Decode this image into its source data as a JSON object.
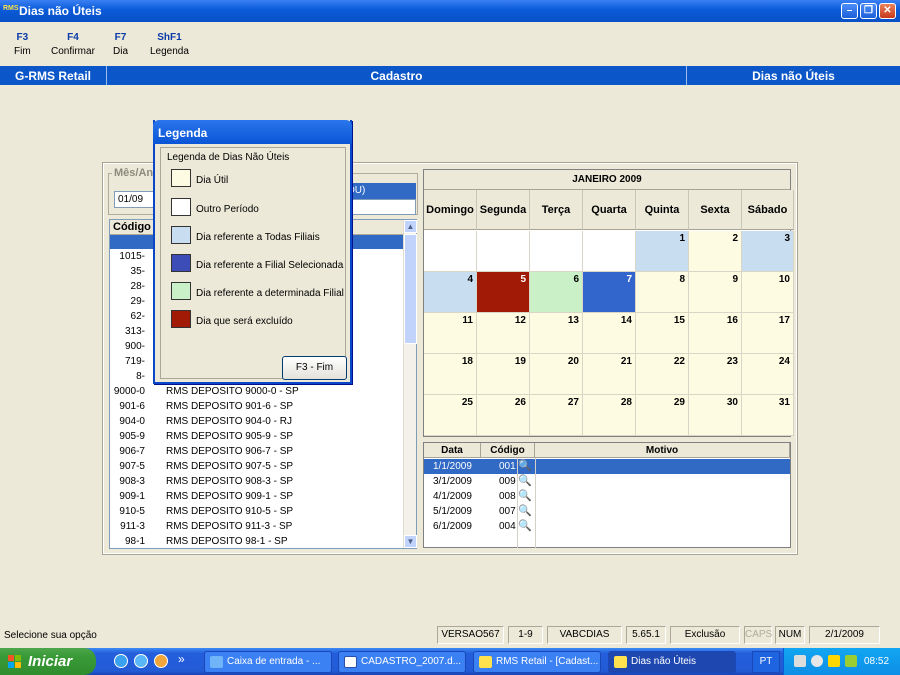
{
  "window": {
    "title": "Dias não Úteis",
    "app_icon": "RMS"
  },
  "fkeys": [
    {
      "key": "F3",
      "label": "Fim"
    },
    {
      "key": "F4",
      "label": "Confirmar"
    },
    {
      "key": "F7",
      "label": "Dia"
    },
    {
      "key": "ShF1",
      "label": "Legenda"
    }
  ],
  "header": {
    "left": "G-RMS Retail",
    "center": "Cadastro",
    "right": "Dias não Úteis"
  },
  "filter": {
    "group_label": "Mês/Ano",
    "month_value": "01/09",
    "selected_suffix": "OU)"
  },
  "list": {
    "header_code": "Código",
    "rows": [
      {
        "code": "1015-",
        "name": ""
      },
      {
        "code": "35-",
        "name": ""
      },
      {
        "code": "28-",
        "name": ""
      },
      {
        "code": "29-",
        "name": ""
      },
      {
        "code": "62-",
        "name": ""
      },
      {
        "code": "313-",
        "name": ""
      },
      {
        "code": "900-",
        "name": ""
      },
      {
        "code": "719-",
        "name": ""
      },
      {
        "code": "8-",
        "name": ""
      },
      {
        "code": "9000-0",
        "name": "RMS DEPOSITO 9000-0 - SP"
      },
      {
        "code": "901-6",
        "name": "RMS DEPOSITO 901-6 - SP"
      },
      {
        "code": "904-0",
        "name": "RMS DEPOSITO 904-0 - RJ"
      },
      {
        "code": "905-9",
        "name": "RMS DEPOSITO 905-9 - SP"
      },
      {
        "code": "906-7",
        "name": "RMS DEPOSITO 906-7 - SP"
      },
      {
        "code": "907-5",
        "name": "RMS DEPOSITO 907-5 - SP"
      },
      {
        "code": "908-3",
        "name": "RMS DEPOSITO 908-3 - SP"
      },
      {
        "code": "909-1",
        "name": "RMS DEPOSITO 909-1 - SP"
      },
      {
        "code": "910-5",
        "name": "RMS DEPOSITO 910-5 - SP"
      },
      {
        "code": "911-3",
        "name": "RMS DEPOSITO 911-3 - SP"
      },
      {
        "code": "98-1",
        "name": "RMS DEPOSITO 98-1 - SP"
      }
    ]
  },
  "calendar": {
    "month_label": "JANEIRO 2009",
    "weekdays": [
      "Domingo",
      "Segunda",
      "Terça",
      "Quarta",
      "Quinta",
      "Sexta",
      "Sábado"
    ],
    "first_weekday_index": 4,
    "days_in_month": 31,
    "colors": {
      "useful": "#fdfbe2",
      "other_period": "#ffffff",
      "all_branches": "#c9ddf0",
      "selected_branch": "#3366cc",
      "specific_branch": "#c9f0c6",
      "excluded": "#a01a05"
    },
    "day_status": {
      "1": "all_branches",
      "3": "all_branches",
      "4": "all_branches",
      "5": "excluded",
      "6": "specific_branch",
      "7": "selected_branch"
    }
  },
  "motivo": {
    "headers": {
      "data": "Data",
      "codigo": "Código",
      "motivo": "Motivo"
    },
    "rows": [
      {
        "data": "1/1/2009",
        "codigo": "001",
        "selected": true
      },
      {
        "data": "3/1/2009",
        "codigo": "009",
        "selected": false
      },
      {
        "data": "4/1/2009",
        "codigo": "008",
        "selected": false
      },
      {
        "data": "5/1/2009",
        "codigo": "007",
        "selected": false
      },
      {
        "data": "6/1/2009",
        "codigo": "004",
        "selected": false
      }
    ]
  },
  "legend": {
    "title": "Legenda",
    "group_label": "Legenda de Dias Não Úteis",
    "items": [
      {
        "label": "Dia Útil",
        "color": "#fdfbe2"
      },
      {
        "label": "Outro Período",
        "color": "#ffffff"
      },
      {
        "label": "Dia referente a Todas Filiais",
        "color": "#c9ddf0"
      },
      {
        "label": "Dia  referente a Filial Selecionada",
        "color": "#3d4db7"
      },
      {
        "label": "Dia referente a determinada Filial",
        "color": "#c9f0c6"
      },
      {
        "label": "Dia que será excluído",
        "color": "#a01a05"
      }
    ],
    "button": "F3 - Fim"
  },
  "status": {
    "message": "Selecione sua opção",
    "version": "VERSAO567",
    "range": "1-9",
    "program": "VABCDIAS",
    "build": "5.65.1",
    "mode": "Exclusão",
    "caps": "CAPS",
    "num": "NUM",
    "date": "2/1/2009"
  },
  "taskbar": {
    "start_label": "Iniciar",
    "items": [
      {
        "label": "Caixa de entrada - ...",
        "icon": "outlook-icon",
        "active": false
      },
      {
        "label": "CADASTRO_2007.d...",
        "icon": "word-icon",
        "active": false
      },
      {
        "label": "RMS Retail - [Cadast...",
        "icon": "rms-icon",
        "active": false
      },
      {
        "label": "Dias não Úteis",
        "icon": "rms-icon",
        "active": true
      }
    ],
    "lang": "PT",
    "clock": "08:52",
    "chevron": "»"
  }
}
